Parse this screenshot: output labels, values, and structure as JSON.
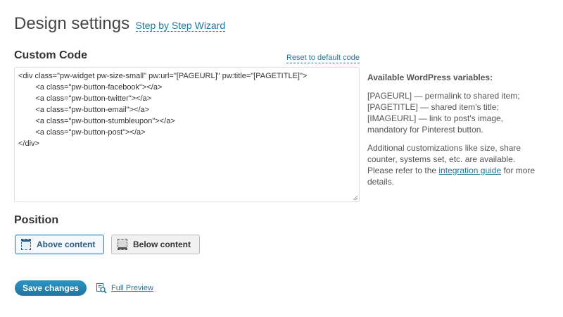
{
  "header": {
    "title": "Design settings",
    "wizard_link": "Step by Step Wizard"
  },
  "custom_code": {
    "title": "Custom Code",
    "reset_link": "Reset to default code",
    "value": "<div class=\"pw-widget pw-size-small\" pw:url=\"[PAGEURL]\" pw:title=\"[PAGETITLE]\">\n        <a class=\"pw-button-facebook\"></a>\n        <a class=\"pw-button-twitter\"></a>\n        <a class=\"pw-button-email\"></a>\n        <a class=\"pw-button-stumbleupon\"></a>\n        <a class=\"pw-button-post\"></a>\n</div>"
  },
  "help": {
    "heading": "Available WordPress variables:",
    "vars_text": "[PAGEURL] — permalink to shared item; [PAGETITLE] — shared item's title; [IMAGEURL] — link to post's image, mandatory for Pinterest button.",
    "additional_pre": "Additional customizations like size, share counter, systems set, etc. are available. Please refer to the ",
    "additional_link": "integration guide",
    "additional_post": " for more details."
  },
  "position": {
    "title": "Position",
    "above_label": "Above content",
    "below_label": "Below content",
    "selected": "above"
  },
  "footer": {
    "save_label": "Save changes",
    "preview_label": "Full Preview"
  },
  "icons": {
    "above": "layout-top-icon",
    "below": "layout-bottom-icon",
    "preview": "preview-magnifier-icon",
    "resize": "resize-grip-icon"
  },
  "colors": {
    "accent": "#21759b",
    "selected_border": "#2e8bc4"
  }
}
